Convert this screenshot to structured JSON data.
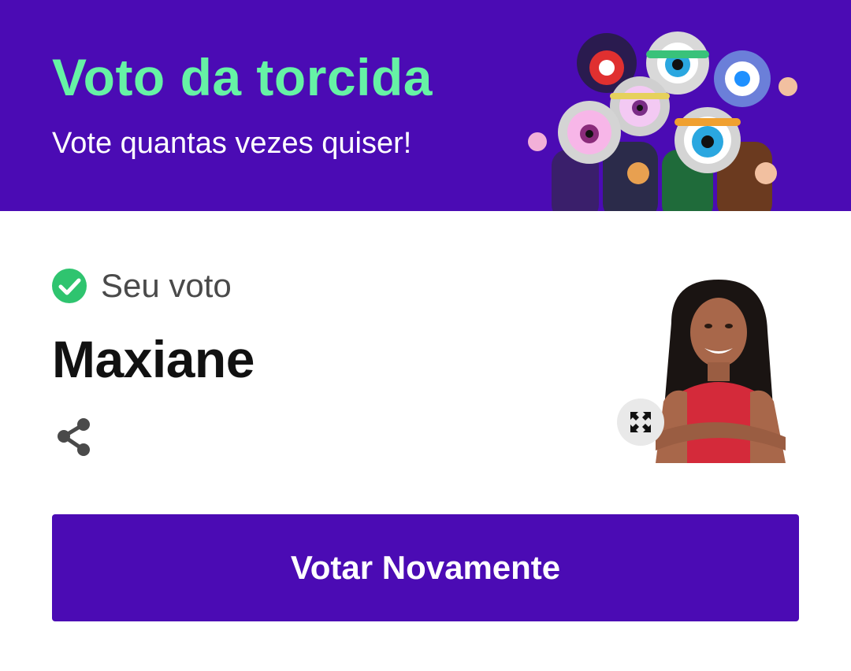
{
  "banner": {
    "title": "Voto da torcida",
    "subtitle": "Vote quantas vezes quiser!",
    "background_color": "#4b0bb4",
    "title_color": "#66f2a5"
  },
  "vote": {
    "label": "Seu voto",
    "candidate_name": "Maxiane",
    "check_color": "#2fc46f"
  },
  "actions": {
    "vote_again_label": "Votar Novamente",
    "button_color": "#4b0bb4"
  },
  "icons": {
    "check": "check-circle-icon",
    "share": "share-icon",
    "expand": "expand-icon"
  }
}
